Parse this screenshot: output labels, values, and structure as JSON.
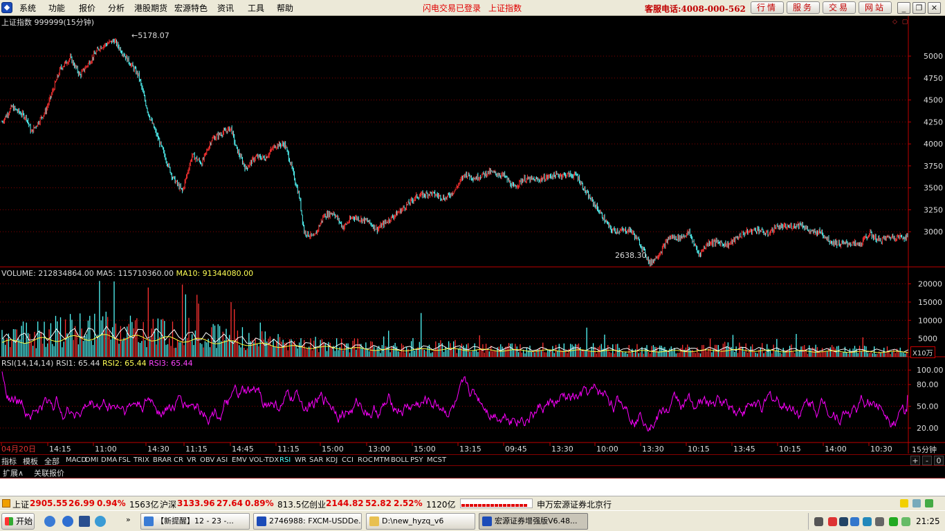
{
  "menubar": {
    "items": [
      "系统",
      "功能",
      "报价",
      "分析",
      "港股期货",
      "宏源特色",
      "资讯",
      "工具",
      "帮助"
    ],
    "status_login": "闪电交易已登录",
    "status_index": "上证指数",
    "hotline": "客服电话:4008-000-562",
    "buttons": [
      "行情",
      "服务",
      "交易",
      "网站"
    ],
    "window_controls": [
      "minimize-icon",
      "restore-icon",
      "close-icon"
    ]
  },
  "price_panel": {
    "title": "上证指数 999999(15分钟)",
    "high_label": "5178.07",
    "low_label": "2638.30",
    "corner_icons": "◇ ▢",
    "y_ticks": [
      "5000",
      "4750",
      "4500",
      "4250",
      "4000",
      "3750",
      "3500",
      "3250",
      "3000"
    ]
  },
  "volume_panel": {
    "title_vol": "VOLUME: 212834864.00",
    "title_ma5": "MA5: 115710360.00",
    "title_ma10": "MA10: 91344080.00",
    "y_ticks": [
      "20000",
      "15000",
      "10000",
      "5000"
    ],
    "unit": "X10万"
  },
  "rsi_panel": {
    "title_main": "RSI(14,14,14)",
    "rsi1": "RSI1: 65.44",
    "rsi2": "RSI2: 65.44",
    "rsi3": "RSI3: 65.44",
    "y_ticks": [
      "100.00",
      "80.00",
      "50.00",
      "20.00"
    ]
  },
  "time_axis": {
    "labels": [
      "04月20日",
      "14:15",
      "11:00",
      "14:30",
      "11:15",
      "14:45",
      "11:15",
      "15:00",
      "13:00",
      "15:00",
      "13:15",
      "09:45",
      "13:30",
      "10:00",
      "13:30",
      "10:15",
      "13:45",
      "10:15",
      "14:00",
      "10:30"
    ],
    "period": "15分钟"
  },
  "indicator_bar": {
    "tabs": [
      "指标",
      "模板",
      "全部"
    ],
    "indicators": [
      "MACD",
      "DMI",
      "DMA",
      "FSL",
      "TRIX",
      "BRAR",
      "CR",
      "VR",
      "OBV",
      "ASI",
      "EMV",
      "VOL-TDX",
      "RSI",
      "WR",
      "SAR",
      "KDJ",
      "CCI",
      "ROC",
      "MTM",
      "BOLL",
      "PSY",
      "MCST"
    ],
    "active": "RSI",
    "controls": [
      "+",
      "-",
      "0"
    ]
  },
  "ext_bar": {
    "items": [
      "扩展∧",
      "关联报价"
    ]
  },
  "statusbar": {
    "sh_name": "上证",
    "sh_val": "2905.55",
    "sh_chg": "26.99",
    "sh_pct": "0.94%",
    "sh_amt": "1563亿",
    "hs_name": "沪深",
    "hs_val": "3133.96",
    "hs_chg": "27.64",
    "hs_pct": "0.89%",
    "hs_amt": "813.5亿",
    "cy_name": "创业",
    "cy_val": "2144.82",
    "cy_chg": "52.82",
    "cy_pct": "2.52%",
    "cy_amt": "1120亿",
    "broker": "申万宏源证券北京行"
  },
  "taskbar": {
    "start": "开始",
    "tasks": [
      "【新提醒】12 - 23 -...",
      "2746988: FXCM-USDDe...",
      "D:\\new_hyzq_v6",
      "宏源证券增强版V6.48..."
    ],
    "clock": "21:25"
  },
  "colors": {
    "up": "#ff3232",
    "down": "#54fcfc",
    "vol_ma": "#ffff40",
    "rsi": "#ff00ff",
    "grid": "#8b0000",
    "axis": "#c00000"
  },
  "chart_data": [
    {
      "type": "line",
      "title": "上证指数 999999(15分钟)",
      "note_series": "15-minute K-line (rendered as candles)",
      "y_range": [
        2600,
        5300
      ],
      "anchors": [
        [
          0,
          4250
        ],
        [
          2,
          4420
        ],
        [
          5,
          4300
        ],
        [
          6,
          4130
        ],
        [
          9,
          4380
        ],
        [
          12,
          4860
        ],
        [
          14,
          4980
        ],
        [
          16,
          4780
        ],
        [
          20,
          5100
        ],
        [
          23,
          5178.07
        ],
        [
          25,
          5020
        ],
        [
          28,
          4780
        ],
        [
          30,
          4350
        ],
        [
          33,
          3920
        ],
        [
          35,
          3620
        ],
        [
          37,
          3460
        ],
        [
          39,
          3870
        ],
        [
          41,
          3780
        ],
        [
          43,
          4050
        ],
        [
          45,
          4120
        ],
        [
          47,
          4180
        ],
        [
          48,
          3960
        ],
        [
          50,
          3720
        ],
        [
          52,
          3850
        ],
        [
          54,
          3840
        ],
        [
          56,
          3980
        ],
        [
          58,
          4000
        ],
        [
          59,
          3820
        ],
        [
          61,
          3400
        ],
        [
          62,
          3000
        ],
        [
          64,
          2930
        ],
        [
          66,
          3180
        ],
        [
          68,
          3220
        ],
        [
          70,
          3050
        ],
        [
          72,
          3170
        ],
        [
          75,
          3120
        ],
        [
          77,
          3030
        ],
        [
          79,
          3120
        ],
        [
          82,
          3250
        ],
        [
          85,
          3400
        ],
        [
          88,
          3440
        ],
        [
          91,
          3380
        ],
        [
          93,
          3480
        ],
        [
          95,
          3660
        ],
        [
          97,
          3610
        ],
        [
          100,
          3680
        ],
        [
          103,
          3640
        ],
        [
          105,
          3500
        ],
        [
          107,
          3600
        ],
        [
          110,
          3590
        ],
        [
          113,
          3640
        ],
        [
          116,
          3650
        ],
        [
          118,
          3640
        ],
        [
          120,
          3430
        ],
        [
          122,
          3280
        ],
        [
          125,
          3020
        ],
        [
          127,
          3010
        ],
        [
          129,
          3020
        ],
        [
          131,
          2860
        ],
        [
          133,
          2638.3
        ],
        [
          135,
          2760
        ],
        [
          137,
          2940
        ],
        [
          139,
          2930
        ],
        [
          141,
          2990
        ],
        [
          143,
          2740
        ],
        [
          145,
          2880
        ],
        [
          147,
          2880
        ],
        [
          149,
          2850
        ],
        [
          152,
          2980
        ],
        [
          155,
          3030
        ],
        [
          157,
          2970
        ],
        [
          159,
          3060
        ],
        [
          161,
          3050
        ],
        [
          164,
          3090
        ],
        [
          166,
          2990
        ],
        [
          168,
          3000
        ],
        [
          170,
          2890
        ],
        [
          172,
          2860
        ],
        [
          174,
          2870
        ],
        [
          176,
          2850
        ],
        [
          178,
          2980
        ],
        [
          180,
          2900
        ],
        [
          182,
          2940
        ],
        [
          185,
          2940
        ]
      ]
    },
    {
      "type": "bar",
      "title": "VOLUME",
      "unit": "X10万",
      "y_range": [
        0,
        22000
      ],
      "profile": [
        [
          0,
          6500
        ],
        [
          10,
          8000
        ],
        [
          20,
          9000
        ],
        [
          30,
          8500
        ],
        [
          40,
          7500
        ],
        [
          50,
          6000
        ],
        [
          60,
          4500
        ],
        [
          70,
          4000
        ],
        [
          80,
          3000
        ],
        [
          90,
          3500
        ],
        [
          100,
          3000
        ],
        [
          110,
          2800
        ],
        [
          120,
          2800
        ],
        [
          130,
          2500
        ],
        [
          140,
          2600
        ],
        [
          150,
          3000
        ],
        [
          160,
          2600
        ],
        [
          170,
          2400
        ],
        [
          185,
          2200
        ]
      ],
      "spikes": [
        [
          20,
          20800
        ],
        [
          30,
          19000
        ],
        [
          37,
          19800
        ],
        [
          40,
          17000
        ],
        [
          47,
          15000
        ],
        [
          86,
          12000
        ],
        [
          120,
          8000
        ],
        [
          150,
          6000
        ]
      ]
    },
    {
      "type": "line",
      "title": "RSI(14,14,14)",
      "series": [
        {
          "name": "RSI1",
          "last": 65.44
        },
        {
          "name": "RSI2",
          "last": 65.44
        },
        {
          "name": "RSI3",
          "last": 65.44
        }
      ],
      "y_range": [
        0,
        105
      ],
      "oscillation": [
        20,
        85
      ]
    }
  ]
}
